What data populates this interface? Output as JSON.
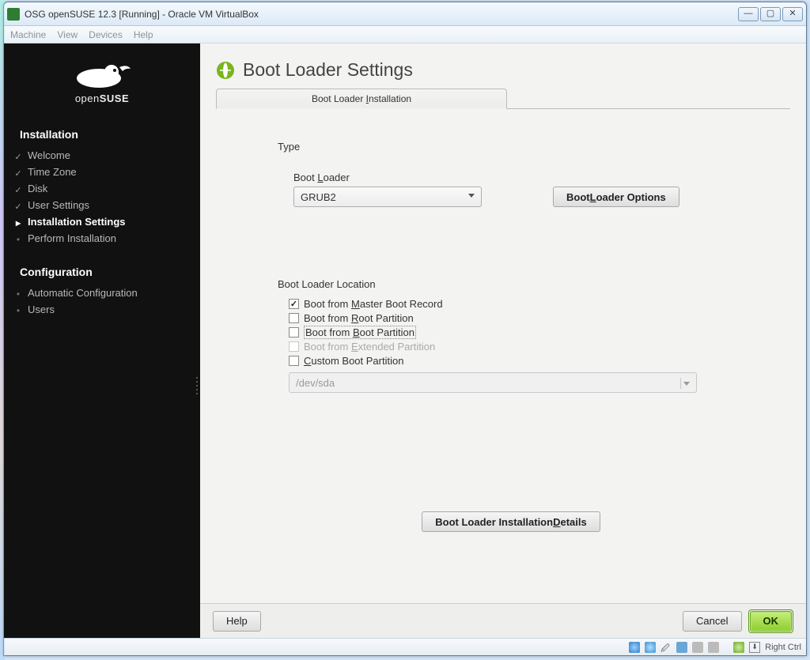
{
  "window": {
    "title": "OSG openSUSE 12.3 [Running] - Oracle VM VirtualBox",
    "controls": {
      "min": "—",
      "max": "▢",
      "close": "✕"
    }
  },
  "menubar": [
    "Machine",
    "View",
    "Devices",
    "Help"
  ],
  "sidebar": {
    "logo_text_a": "open",
    "logo_text_b": "SUSE",
    "sections": [
      {
        "heading": "Installation",
        "items": [
          {
            "label": "Welcome",
            "state": "done"
          },
          {
            "label": "Time Zone",
            "state": "done"
          },
          {
            "label": "Disk",
            "state": "done"
          },
          {
            "label": "User Settings",
            "state": "done"
          },
          {
            "label": "Installation Settings",
            "state": "active"
          },
          {
            "label": "Perform Installation",
            "state": "bullet"
          }
        ]
      },
      {
        "heading": "Configuration",
        "items": [
          {
            "label": "Automatic Configuration",
            "state": "bullet"
          },
          {
            "label": "Users",
            "state": "bullet"
          }
        ]
      }
    ]
  },
  "page": {
    "title": "Boot Loader Settings",
    "tab_label_pre": "Boot Loader ",
    "tab_label_u": "I",
    "tab_label_post": "nstallation",
    "type_group": "Type",
    "bootloader_label_pre": "Boot ",
    "bootloader_label_u": "L",
    "bootloader_label_post": "oader",
    "bootloader_value": "GRUB2",
    "options_btn_pre": "Boot ",
    "options_btn_u": "L",
    "options_btn_post": "oader Options",
    "location_label": "Boot Loader Location",
    "checks": [
      {
        "pre": "Boot from ",
        "u": "M",
        "post": "aster Boot Record",
        "checked": true,
        "disabled": false,
        "focused": false
      },
      {
        "pre": "Boot from ",
        "u": "R",
        "post": "oot Partition",
        "checked": false,
        "disabled": false,
        "focused": false
      },
      {
        "pre": "Boot from ",
        "u": "B",
        "post": "oot Partition",
        "checked": false,
        "disabled": false,
        "focused": true
      },
      {
        "pre": "Boot from ",
        "u": "E",
        "post": "xtended Partition",
        "checked": false,
        "disabled": true,
        "focused": false
      },
      {
        "pre": "",
        "u": "C",
        "post": "ustom Boot Partition",
        "checked": false,
        "disabled": false,
        "focused": false
      }
    ],
    "custom_value": "/dev/sda",
    "details_btn_pre": "Boot Loader Installation ",
    "details_btn_u": "D",
    "details_btn_post": "etails"
  },
  "footer": {
    "help": "Help",
    "cancel": "Cancel",
    "ok": "OK"
  },
  "vb_status": {
    "key_label": "Right Ctrl"
  }
}
